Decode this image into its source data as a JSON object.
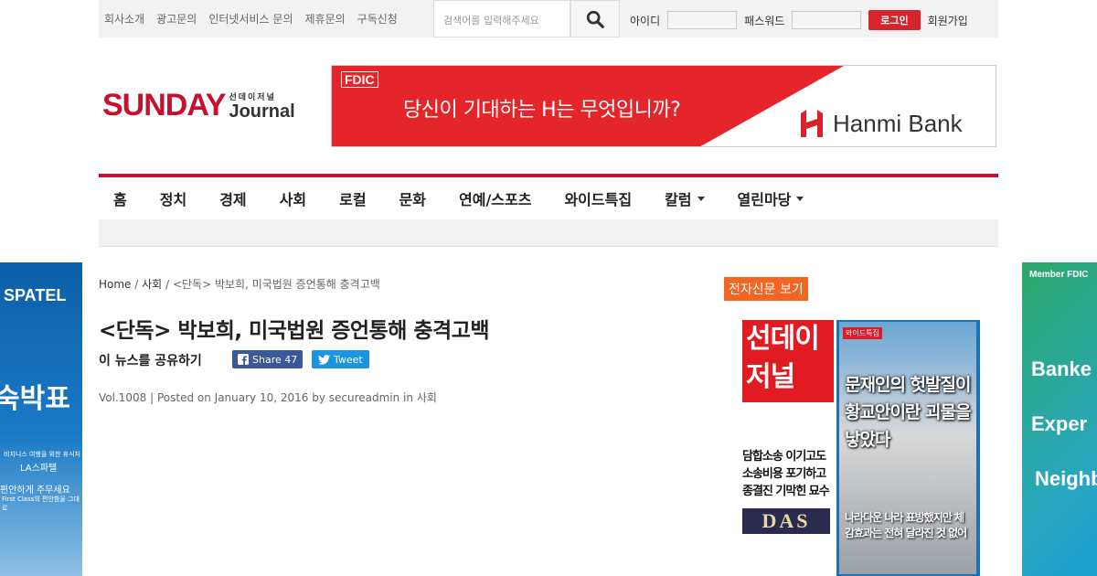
{
  "top_links": [
    "회사소개",
    "광고문의",
    "인터넷서비스 문의",
    "제휴문의",
    "구독신청"
  ],
  "search": {
    "placeholder": "검색어를 입력해주세요"
  },
  "login": {
    "id_label": "아이디",
    "pw_label": "패스워드",
    "login_button": "로그인",
    "signup": "회원가입"
  },
  "logo": {
    "main": "SUNDAY",
    "kr": "선데이저널",
    "sub": "Journal"
  },
  "banner": {
    "fdic": "FDIC",
    "headline": "당신이 기대하는 H는 무엇입니까?",
    "brand": "Hanmi Bank"
  },
  "nav": [
    {
      "label": "홈",
      "dropdown": false
    },
    {
      "label": "정치",
      "dropdown": false
    },
    {
      "label": "경제",
      "dropdown": false
    },
    {
      "label": "사회",
      "dropdown": false
    },
    {
      "label": "로컬",
      "dropdown": false
    },
    {
      "label": "문화",
      "dropdown": false
    },
    {
      "label": "연예/스포츠",
      "dropdown": false
    },
    {
      "label": "와이드특집",
      "dropdown": false
    },
    {
      "label": "칼럼",
      "dropdown": true
    },
    {
      "label": "열린마당",
      "dropdown": true
    }
  ],
  "breadcrumb": {
    "home": "Home",
    "category": "사회",
    "current": "<단독> 박보희, 미국법원 증언통해 충격고백",
    "sep": "/"
  },
  "article": {
    "title": "<단독> 박보희, 미국법원 증언통해 충격고백",
    "share_label": "이 뉴스를 공유하기",
    "fb_share": "Share 47",
    "tweet": "Tweet",
    "meta": "Vol.1008 | Posted on January 10, 2016 by secureadmin in 사회"
  },
  "epaper": {
    "label": "전자신문 보기",
    "mast_line1": "선데이",
    "mast_line2": "저널",
    "headline_left": "담합소송 이기고도 소송비용 포기하고 종결진 기막힌 묘수",
    "das": "DAS",
    "tag": "와이드특집",
    "headline_main": "문재인의 헛발질이 황교안이란 괴물을 낳았다",
    "headline_sub": "나라다운 나라 표방했지만 체감효과는 전혀 달라진 것 없어"
  },
  "ad_left": {
    "brand": "SPATEL",
    "big": "숙박표",
    "line1": "비지니스 여행을 위한 휴식처",
    "line2": "LA스파텔",
    "line3": "편안하게 주무세요",
    "line4": "First Class의 편안함을 그대로"
  },
  "ad_right": {
    "fdic": "Member FDIC",
    "w1": "Banke",
    "w2": "Exper",
    "w3": "Neighb"
  },
  "colors": {
    "brand_red": "#c8102e",
    "orange": "#f26522",
    "facebook": "#3b5998",
    "twitter": "#1b95e0"
  }
}
